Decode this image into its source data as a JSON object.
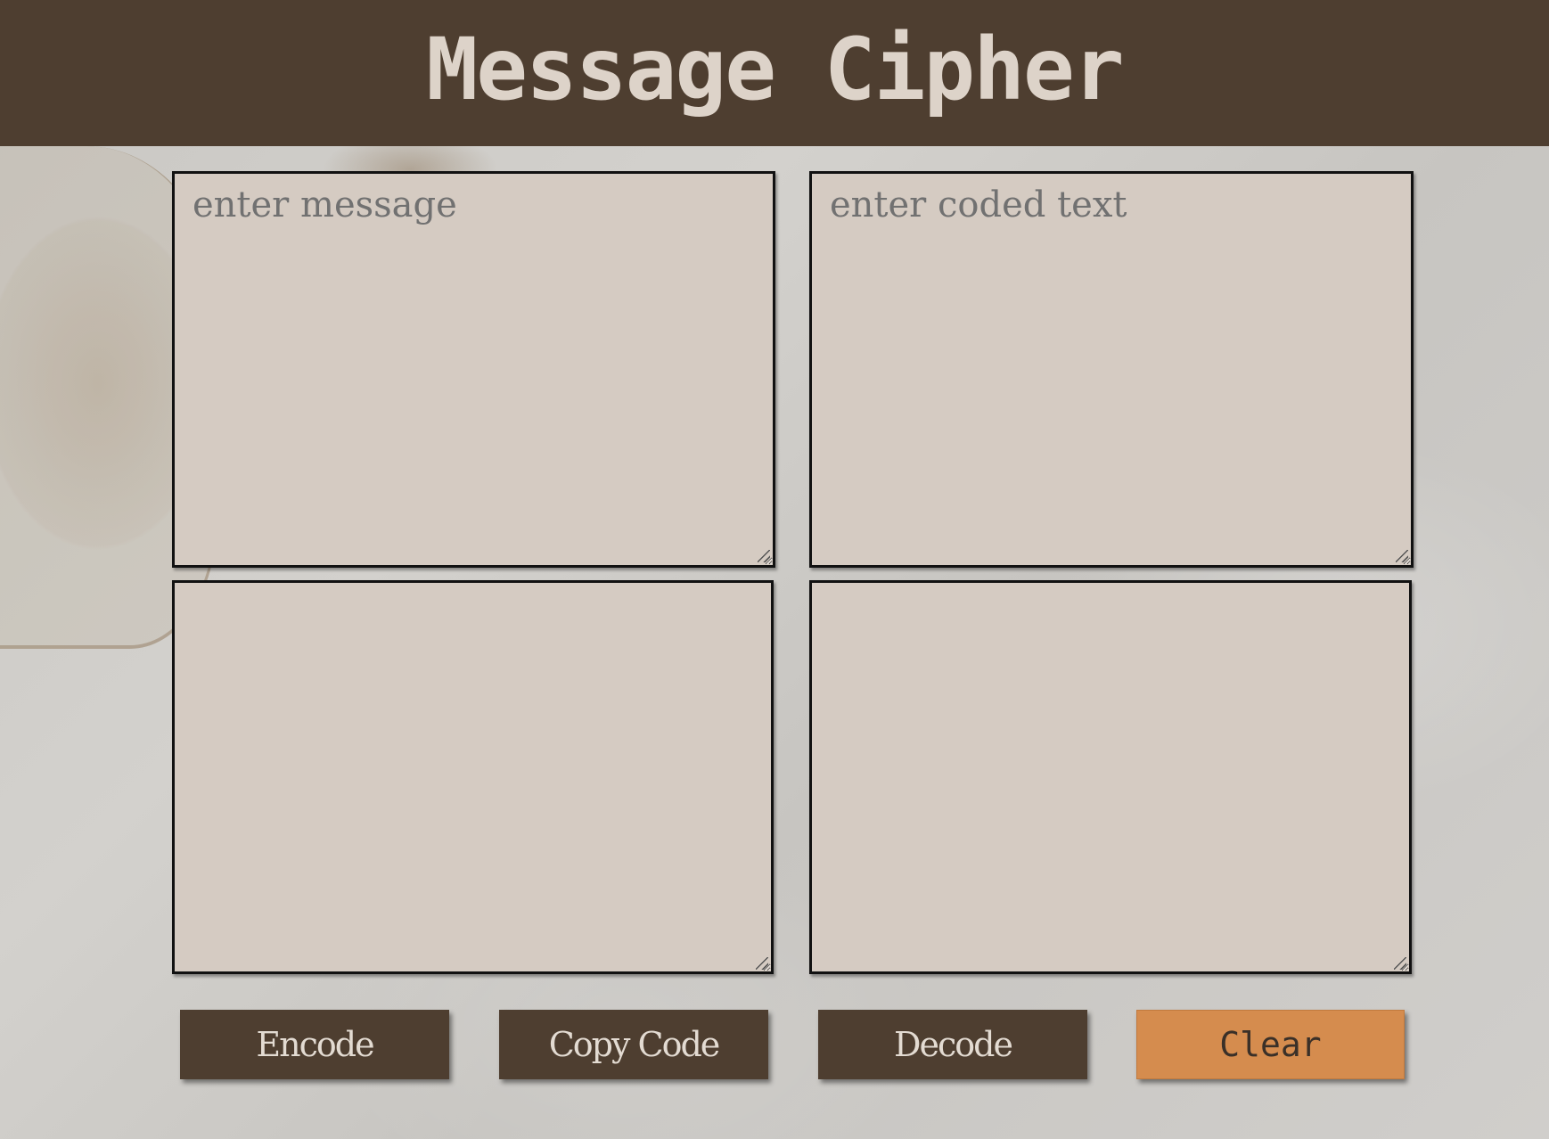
{
  "header": {
    "title": "Message Cipher"
  },
  "inputs": {
    "message_placeholder": "enter message",
    "coded_text_placeholder": "enter coded text",
    "encoded_output_value": "",
    "decoded_output_value": ""
  },
  "buttons": {
    "encode_label": "Encode",
    "copy_code_label": "Copy Code",
    "decode_label": "Decode",
    "clear_label": "Clear"
  },
  "colors": {
    "header_bg": "#4e3e30",
    "title_text": "#ddd3c9",
    "panel_bg": "#d5cbc2",
    "button_bg": "#4e3e30",
    "clear_button_bg": "#d58c4e"
  }
}
